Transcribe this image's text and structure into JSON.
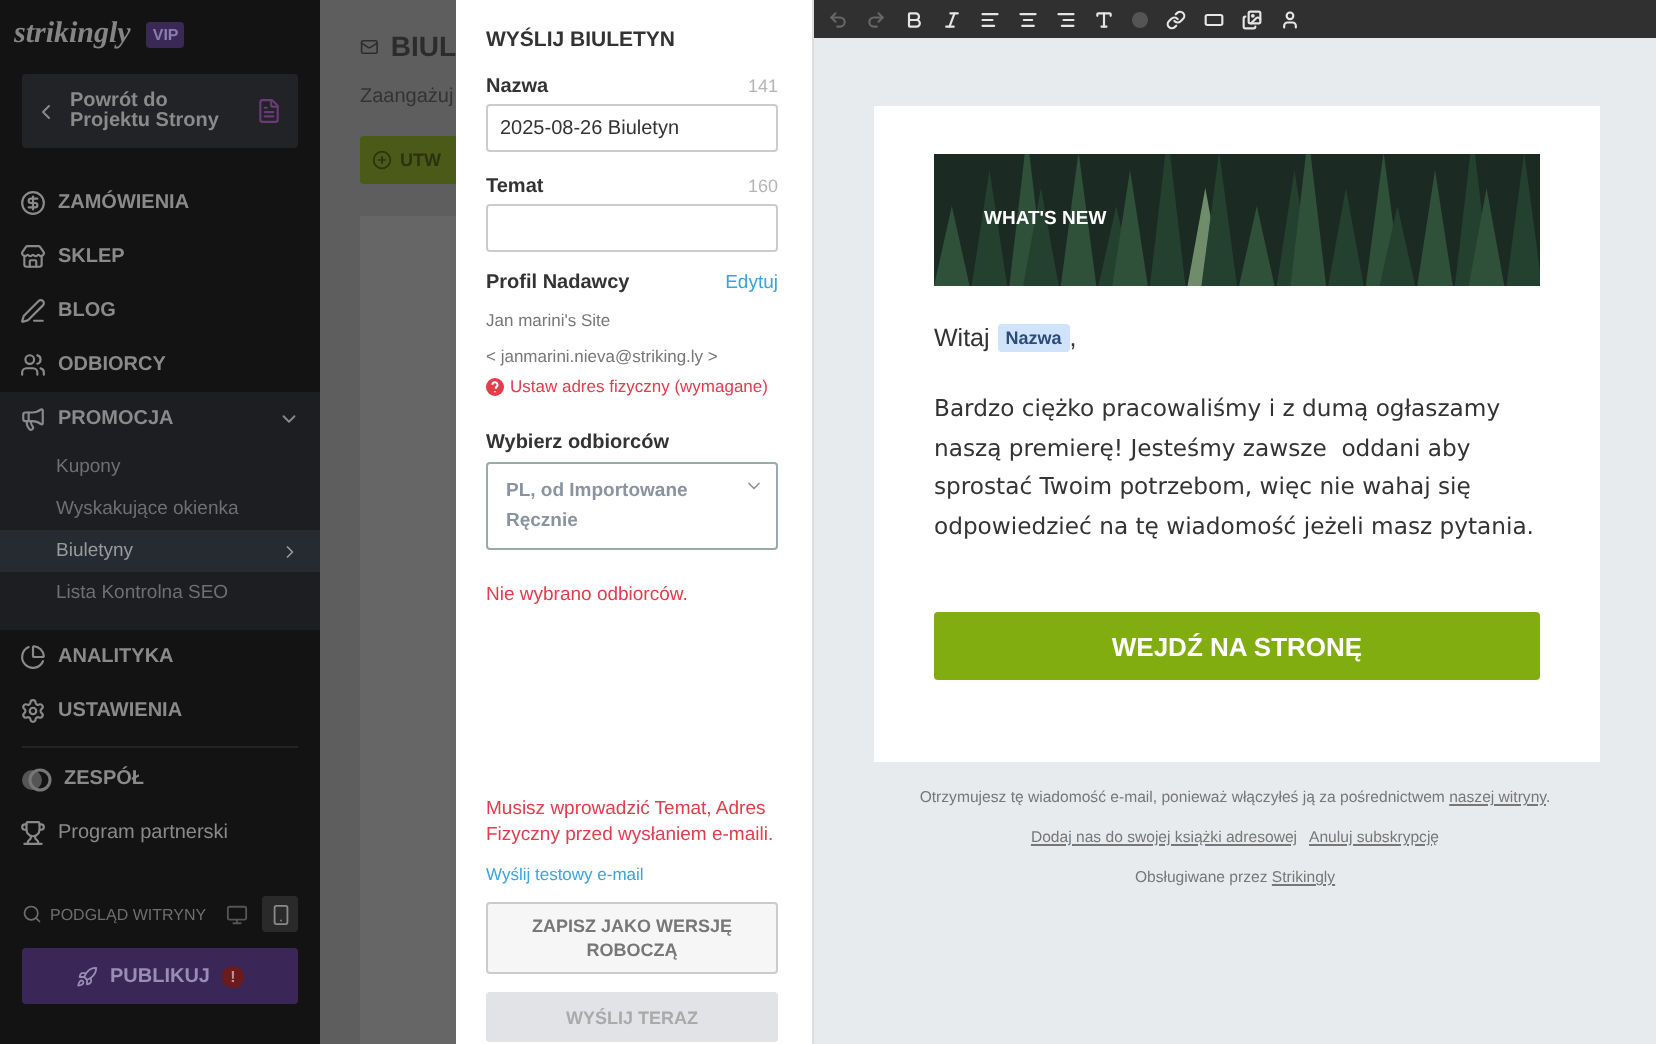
{
  "sidebar": {
    "logo": "strikingly",
    "badge": "VIP",
    "back_button": "Powrót do Projektu Strony",
    "items": [
      {
        "kind": "section",
        "label": "ZAMÓWIENIA"
      },
      {
        "kind": "section",
        "label": "SKLEP"
      },
      {
        "kind": "section",
        "label": "BLOG"
      },
      {
        "kind": "section",
        "label": "ODBIORCY"
      },
      {
        "kind": "group",
        "label": "PROMOCJA",
        "expanded": true,
        "children": [
          {
            "label": "Kupony",
            "selected": false
          },
          {
            "label": "Wyskakujące okienka",
            "selected": false
          },
          {
            "label": "Biuletyny",
            "selected": true
          },
          {
            "label": "Lista Kontrolna SEO",
            "selected": false
          }
        ]
      },
      {
        "kind": "section",
        "label": "ANALITYKA"
      },
      {
        "kind": "section",
        "label": "USTAWIENIA"
      },
      {
        "kind": "extra",
        "label": "ZESPÓŁ"
      },
      {
        "kind": "plain",
        "label": "Program partnerski"
      }
    ],
    "preview": {
      "label": "PODGLĄD WITRYNY",
      "devices": [
        {
          "kind": "desktop",
          "selected": false
        },
        {
          "kind": "mobile",
          "selected": true
        }
      ]
    },
    "publish": {
      "label": "PUBLIKUJ",
      "alert": "!"
    }
  },
  "background_page": {
    "title": "BIUL",
    "subtitle": "Zaangażuj",
    "button": "UTW"
  },
  "panel": {
    "title": "WYŚLIJ BIULETYN",
    "fields": [
      {
        "label": "Nazwa",
        "counter": "141",
        "value": "2025-08-26 Biuletyn"
      },
      {
        "label": "Temat",
        "counter": "160"
      }
    ],
    "sender": {
      "label": "Profil Nadawcy",
      "edit": "Edytuj",
      "name": "Jan marini's Site",
      "email": "< janmarini.nieva@striking.ly >",
      "warning": "Ustaw adres fizyczny (wymagane)"
    },
    "recipients": {
      "label": "Wybierz odbiorców",
      "selection": "PL, od Importowane Ręcznie",
      "error": "Nie wybrano odbiorców."
    },
    "error": "Musisz wprowadzić Temat, Adres Fizyczny przed wysłaniem e-maili.",
    "test_link": "Wyślij testowy e-mail",
    "save": "ZAPISZ JAKO WERSJĘ ROBOCZĄ",
    "send": {
      "label": "WYŚLIJ TERAZ",
      "disabled": true
    }
  },
  "email": {
    "banner": "WHAT'S NEW",
    "greeting": "Witaj",
    "merge_tag": "Nazwa",
    "greeting_end": ",",
    "body": "Bardzo ciężko pracowaliśmy i z dumą ogłaszamy naszą premierę! Jesteśmy zawsze  oddani aby sprostać Twoim potrzebom, więc nie wahaj się odpowiedzieć na tę wiadomość jeżeli masz pytania.",
    "button": "WEJDŹ NA STRONĘ",
    "footer": {
      "notice": "Otrzymujesz tę wiadomość e-mail, ponieważ włączyłeś ją za pośrednictwem",
      "notice_link": "naszej witryny",
      "notice_end": ".",
      "links": [
        "Dodaj nas do swojej książki adresowej",
        "Anuluj subskrypcję"
      ],
      "powered": "Obsługiwane przez",
      "powered_link": "Strikingly"
    }
  }
}
